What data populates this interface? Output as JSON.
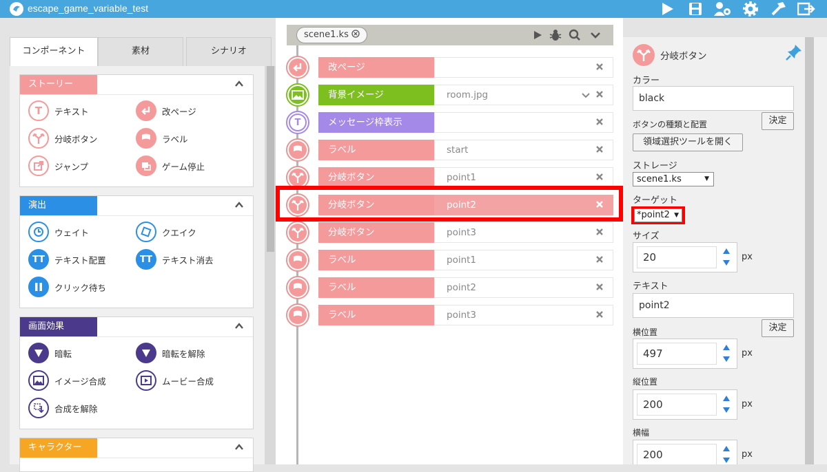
{
  "app": {
    "title": "escape_game_variable_test"
  },
  "colors": {
    "accent": "#46a6dd",
    "pink": "#f49a9a",
    "green": "#7dbf1f",
    "purple": "#a589e8",
    "blue": "#2b8fe6",
    "navy": "#4b3a8c",
    "orange": "#f6a623",
    "red": "#ff0000"
  },
  "left_tabs": [
    "コンポーネント",
    "素材",
    "シナリオ"
  ],
  "sections": {
    "story": {
      "title": "ストーリー",
      "items": [
        "テキスト",
        "改ページ",
        "分岐ボタン",
        "ラベル",
        "ジャンプ",
        "ゲーム停止"
      ]
    },
    "effect": {
      "title": "演出",
      "items": [
        "ウェイト",
        "クエイク",
        "テキスト配置",
        "テキスト消去",
        "クリック待ち"
      ]
    },
    "screen": {
      "title": "画面効果",
      "items": [
        "暗転",
        "暗転を解除",
        "イメージ合成",
        "ムービー合成",
        "合成を解除"
      ]
    },
    "character": {
      "title": "キャラクター"
    }
  },
  "scene": {
    "tab": "scene1.ks"
  },
  "rows": [
    {
      "tag": "改ページ",
      "value": "",
      "kind": "pink",
      "icon": "page-break-icon"
    },
    {
      "tag": "背景イメージ",
      "value": "room.jpg",
      "kind": "green",
      "icon": "background-image-icon"
    },
    {
      "tag": "メッセージ枠表示",
      "value": "",
      "kind": "purple",
      "icon": "message-window-icon"
    },
    {
      "tag": "ラベル",
      "value": "start",
      "kind": "pink",
      "icon": "flag-icon"
    },
    {
      "tag": "分岐ボタン",
      "value": "point1",
      "kind": "pink",
      "icon": "branch-icon"
    },
    {
      "tag": "分岐ボタン",
      "value": "point2",
      "kind": "pink",
      "icon": "branch-icon"
    },
    {
      "tag": "分岐ボタン",
      "value": "point3",
      "kind": "pink",
      "icon": "branch-icon"
    },
    {
      "tag": "ラベル",
      "value": "point1",
      "kind": "pink",
      "icon": "flag-icon"
    },
    {
      "tag": "ラベル",
      "value": "point2",
      "kind": "pink",
      "icon": "flag-icon"
    },
    {
      "tag": "ラベル",
      "value": "point3",
      "kind": "pink",
      "icon": "flag-icon"
    }
  ],
  "panel": {
    "title": "分岐ボタン",
    "color_label": "カラー",
    "color_value": "black",
    "decide": "決定",
    "button_type_label": "ボタンの種類と配置",
    "region_tool": "領域選択ツールを開く",
    "storage_label": "ストレージ",
    "storage_value": "scene1.ks",
    "target_label": "ターゲット",
    "target_value": "*point2",
    "size_label": "サイズ",
    "size_value": "20",
    "px": "px",
    "text_label": "テキスト",
    "text_value": "point2",
    "x_label": "横位置",
    "x_value": "497",
    "y_label": "縦位置",
    "y_value": "200",
    "w_label": "横幅",
    "w_value": "200"
  }
}
